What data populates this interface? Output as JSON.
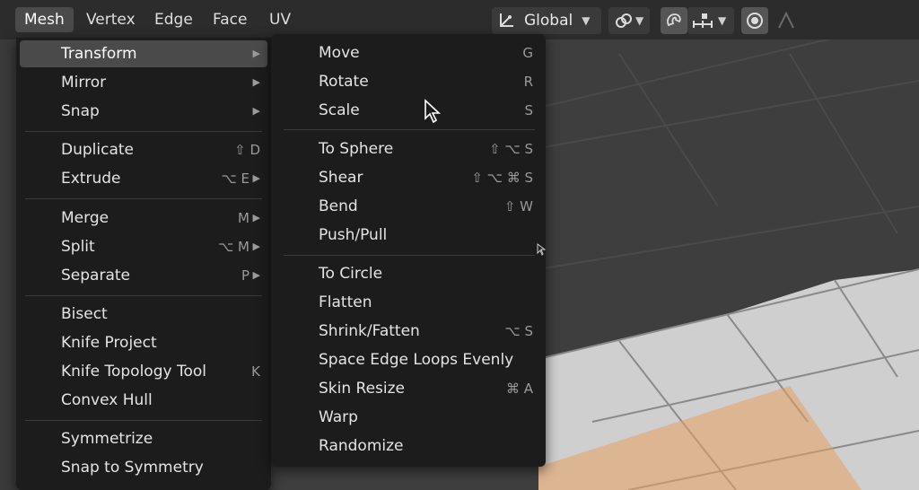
{
  "header": {
    "menus": [
      "Mesh",
      "Vertex",
      "Edge",
      "Face",
      "UV"
    ],
    "orientation_label": "Global",
    "icons": [
      "transform-orientation-icon",
      "chevron-down-icon",
      "pivot-link-icon",
      "snap-magnet-icon",
      "snap-increment-icon",
      "proportional-edit-icon",
      "falloff-curve-icon"
    ]
  },
  "mesh_menu": {
    "groups": [
      [
        {
          "label": "Transform",
          "shortcut": "",
          "submenu": true,
          "highlighted": true
        },
        {
          "label": "Mirror",
          "shortcut": "",
          "submenu": true
        },
        {
          "label": "Snap",
          "shortcut": "",
          "submenu": true
        }
      ],
      [
        {
          "label": "Duplicate",
          "shortcut": "⇧ D",
          "submenu": false
        },
        {
          "label": "Extrude",
          "shortcut": "⌥ E",
          "submenu": true
        }
      ],
      [
        {
          "label": "Merge",
          "shortcut": "M",
          "submenu": true
        },
        {
          "label": "Split",
          "shortcut": "⌥ M",
          "submenu": true
        },
        {
          "label": "Separate",
          "shortcut": "P",
          "submenu": true
        }
      ],
      [
        {
          "label": "Bisect",
          "shortcut": "",
          "submenu": false
        },
        {
          "label": "Knife Project",
          "shortcut": "",
          "submenu": false
        },
        {
          "label": "Knife Topology Tool",
          "shortcut": "K",
          "submenu": false
        },
        {
          "label": "Convex Hull",
          "shortcut": "",
          "submenu": false
        }
      ],
      [
        {
          "label": "Symmetrize",
          "shortcut": "",
          "submenu": false
        },
        {
          "label": "Snap to Symmetry",
          "shortcut": "",
          "submenu": false
        }
      ]
    ]
  },
  "transform_menu": {
    "groups": [
      [
        {
          "label": "Move",
          "shortcut": "G"
        },
        {
          "label": "Rotate",
          "shortcut": "R"
        },
        {
          "label": "Scale",
          "shortcut": "S"
        }
      ],
      [
        {
          "label": "To Sphere",
          "shortcut": "⇧ ⌥ S"
        },
        {
          "label": "Shear",
          "shortcut": "⇧ ⌥ ⌘ S"
        },
        {
          "label": "Bend",
          "shortcut": "⇧ W"
        },
        {
          "label": "Push/Pull",
          "shortcut": ""
        }
      ],
      [
        {
          "label": "To Circle",
          "shortcut": ""
        },
        {
          "label": "Flatten",
          "shortcut": ""
        },
        {
          "label": "Shrink/Fatten",
          "shortcut": "⌥ S"
        },
        {
          "label": "Space Edge Loops Evenly",
          "shortcut": ""
        },
        {
          "label": "Skin Resize",
          "shortcut": "⌘ A"
        },
        {
          "label": "Warp",
          "shortcut": ""
        },
        {
          "label": "Randomize",
          "shortcut": ""
        }
      ]
    ]
  },
  "colors": {
    "menu_bg": "#1c1c1c",
    "highlight": "#4a4a4a",
    "header_bg": "#2c2c2c",
    "selection_orange": "#e8a060"
  }
}
